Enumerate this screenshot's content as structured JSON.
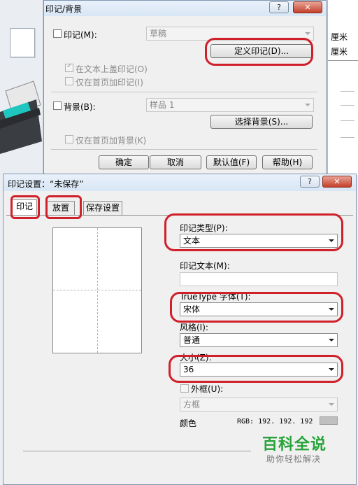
{
  "top_dialog": {
    "title": "印记/背景",
    "help_btn": "?",
    "close_btn": "✕",
    "stamp_checkbox_label": "印记(M):",
    "stamp_combo_value": "草稿",
    "define_stamp_btn": "定义印记(D)...",
    "stamp_on_text_label": "在文本上盖印记(O)",
    "stamp_first_page_label": "仅在首页加印记(I)",
    "background_checkbox_label": "背景(B):",
    "background_combo_value": "样品 1",
    "select_background_btn": "选择背景(S)...",
    "background_first_page_label": "仅在首页加背景(K)",
    "ok_btn": "确定",
    "cancel_btn": "取消",
    "default_btn": "默认值(F)",
    "help_button": "帮助(H)"
  },
  "right_partial": {
    "line1": "厘米",
    "line2": "厘米"
  },
  "stamp_dialog": {
    "title": "印记设置：“未保存”",
    "help_btn": "?",
    "close_btn": "✕",
    "tabs": [
      "印记",
      "放置",
      "保存设置"
    ],
    "stamp_type_label": "印记类型(P):",
    "stamp_type_value": "文本",
    "stamp_text_label": "印记文本(M):",
    "stamp_text_value": "",
    "font_label": "TrueType 字体(T):",
    "font_value": "宋体",
    "style_label": "风格(I):",
    "style_value": "普通",
    "size_label": "大小(Z):",
    "size_value": "36",
    "frame_label": "外框(U):",
    "frame_value": "方框",
    "color_label": "颜色",
    "color_rgb": "RGB:  192.  192.  192",
    "color_swatch": "#c0c0c0"
  },
  "watermark": {
    "title": "百科全说",
    "subtitle": "助你轻松解决"
  },
  "colors": {
    "highlight_ring": "#d0202a",
    "watermark_green": "#27a33a"
  }
}
